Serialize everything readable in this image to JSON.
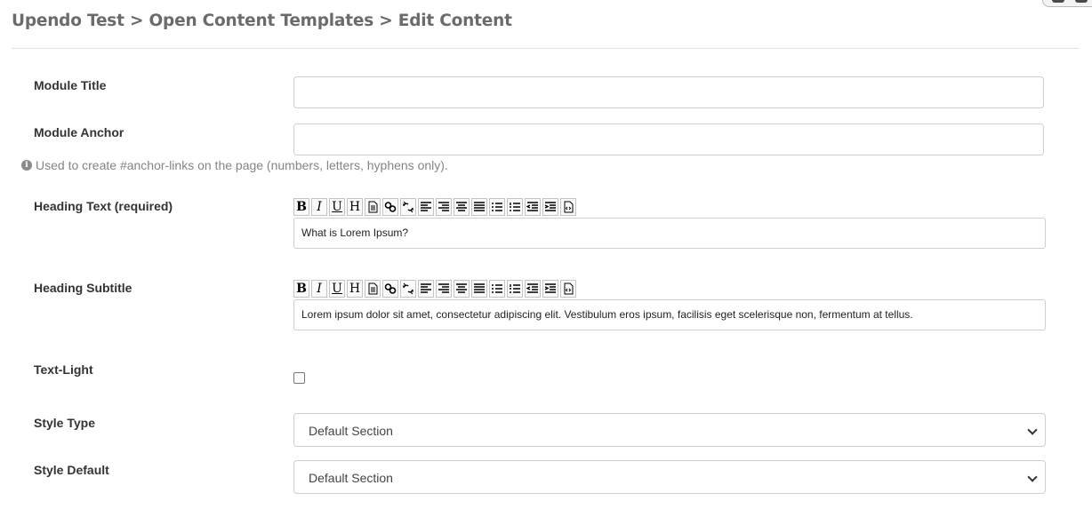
{
  "breadcrumb": "Upendo Test > Open Content Templates > Edit Content",
  "fields": {
    "module_title": {
      "label": "Module Title",
      "value": ""
    },
    "module_anchor": {
      "label": "Module Anchor",
      "value": "",
      "help": "Used to create #anchor-links on the page (numbers, letters, hyphens only)."
    },
    "heading_text": {
      "label": "Heading Text (required)",
      "value": "What is Lorem Ipsum?"
    },
    "heading_subtitle": {
      "label": "Heading Subtitle",
      "value": "Lorem ipsum dolor sit amet, consectetur adipiscing elit. Vestibulum eros ipsum, facilisis eget scelerisque non, fermentum at tellus."
    },
    "text_light": {
      "label": "Text-Light",
      "checked": false
    },
    "style_type": {
      "label": "Style Type",
      "selected": "Default Section"
    },
    "style_default": {
      "label": "Style Default",
      "selected": "Default Section"
    }
  },
  "toolbar": {
    "glyph_bold": "B",
    "glyph_italic": "I",
    "glyph_underline": "U",
    "glyph_heading": "H",
    "buttons": [
      "bold-icon",
      "italic-icon",
      "underline-icon",
      "heading-icon",
      "paragraph-icon",
      "link-icon",
      "unlink-icon",
      "align-left-icon",
      "align-right-icon",
      "align-center-icon",
      "align-justify-icon",
      "bullet-list-icon",
      "numbered-list-icon",
      "outdent-icon",
      "indent-icon",
      "source-code-icon"
    ]
  },
  "colors": {
    "breadcrumb": "#6b6b6b",
    "border": "#cfcfcf",
    "help_text": "#858585"
  }
}
